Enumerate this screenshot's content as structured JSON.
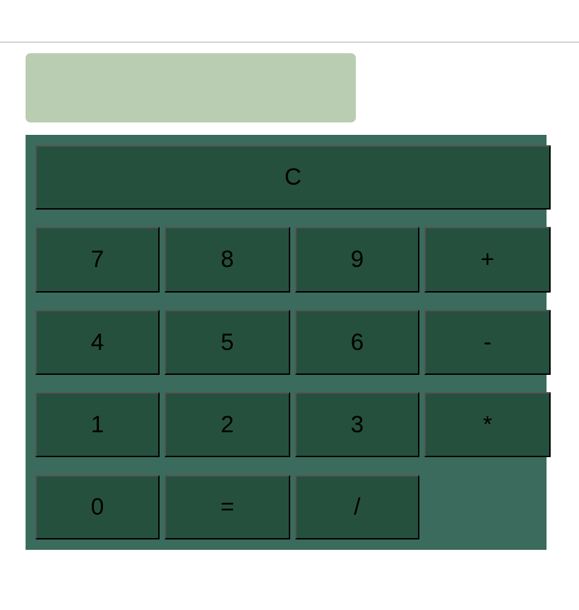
{
  "display": {
    "value": ""
  },
  "keys": {
    "clear": "C",
    "row1": [
      "7",
      "8",
      "9",
      "+"
    ],
    "row2": [
      "4",
      "5",
      "6",
      "-"
    ],
    "row3": [
      "1",
      "2",
      "3",
      "*"
    ],
    "row4": [
      "0",
      "=",
      "/"
    ]
  },
  "colors": {
    "display_bg": "#b8cdb2",
    "keypad_bg": "#3a6b5d",
    "key_bg": "#25503e"
  }
}
